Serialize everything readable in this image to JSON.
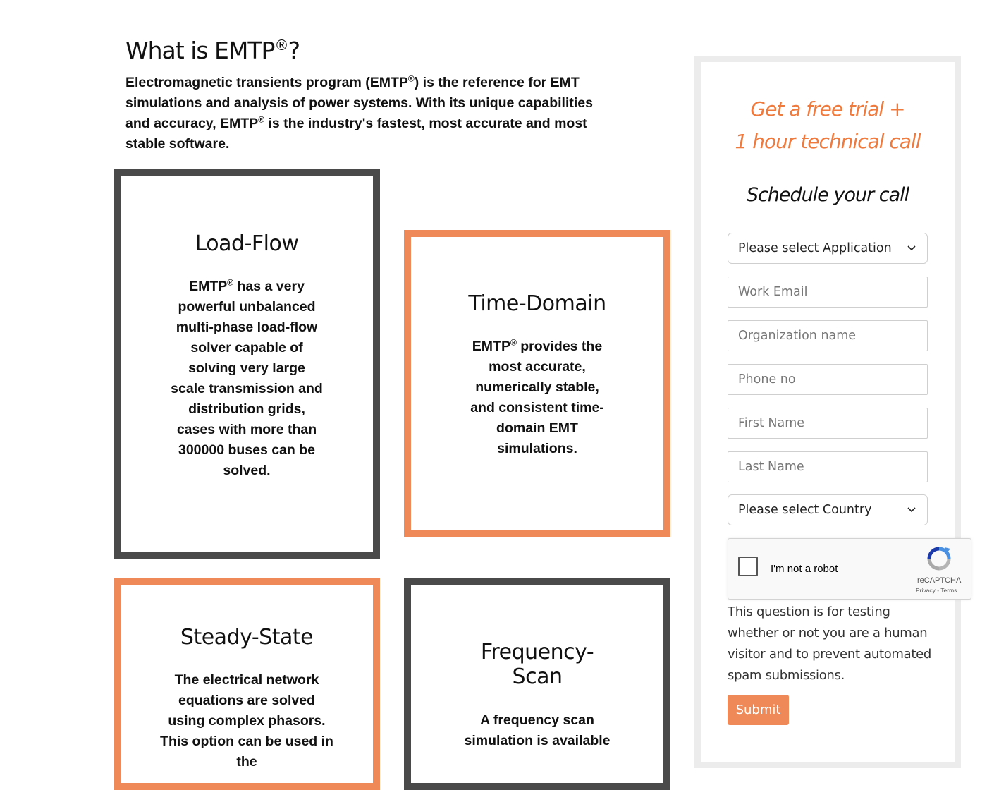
{
  "intro_section": {
    "heading_prefix": "What is EMTP",
    "heading_reg": "®",
    "heading_suffix": "?",
    "text_1": "Electromagnetic transients program (EMTP",
    "text_reg_1": "®",
    "text_2": ") is the reference for EMT simulations and analysis of power systems. With its unique capabilities and accuracy, EMTP",
    "text_reg_2": "®",
    "text_3": " is the industry's fastest, most accurate and most stable software."
  },
  "cards": {
    "load_flow": {
      "title": "Load-Flow",
      "text_1": "EMTP",
      "reg": "®",
      "text_2": " has a very powerful unbalanced multi-phase load-flow solver capable of solving very large scale transmission and distribution grids, cases with more than 300000 buses can be solved."
    },
    "time_domain": {
      "title": "Time-Domain",
      "text_1": "EMTP",
      "reg": "®",
      "text_2": " provides the most accurate, numerically stable, and consistent time-domain EMT simulations."
    },
    "steady_state": {
      "title": "Steady-State",
      "text": "The electrical network equations are solved using complex phasors. This option can be used in the"
    },
    "frequency_scan": {
      "title_1": "Frequency-",
      "title_2": "Scan",
      "text": "A frequency scan simulation is available"
    }
  },
  "form": {
    "promo_line_1": "Get a free trial +",
    "promo_line_2": "1 hour technical call",
    "schedule_title": "Schedule your call",
    "application_select": "Please select Application",
    "work_email_placeholder": "Work Email",
    "organization_placeholder": "Organization name",
    "phone_placeholder": "Phone no",
    "first_name_placeholder": "First Name",
    "last_name_placeholder": "Last Name",
    "country_select": "Please select Country",
    "recaptcha": {
      "label": "I'm not a robot",
      "brand": "reCAPTCHA",
      "terms": "Privacy - Terms"
    },
    "disclaimer": "This question is for testing whether or not you are a human visitor and to prevent automated spam submissions.",
    "submit_label": "Submit"
  },
  "colors": {
    "accent_orange": "#ef8957",
    "card_dark": "#4a4a4a",
    "panel_border": "#ececec"
  },
  "icons": [
    "chevron-down-icon",
    "recaptcha-logo-icon"
  ]
}
